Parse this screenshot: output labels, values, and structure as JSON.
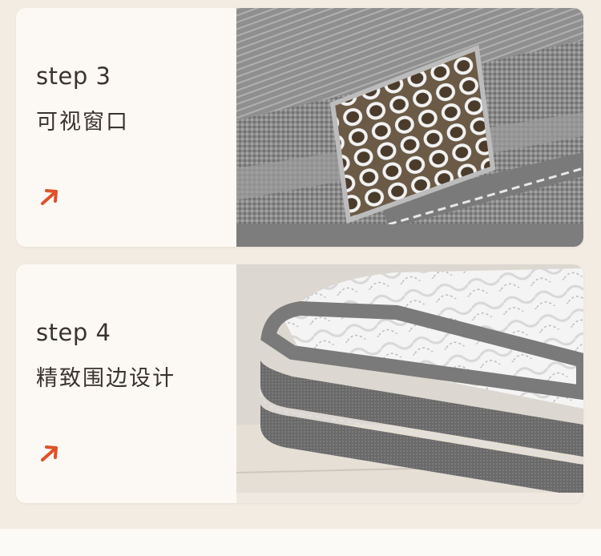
{
  "cards": [
    {
      "step": "step 3",
      "title": "可视窗口",
      "arrow_icon": "arrow-up-right-icon",
      "image": "mattress-mesh-window-photo"
    },
    {
      "step": "step 4",
      "title": "精致围边设计",
      "arrow_icon": "arrow-up-right-icon",
      "image": "mattress-edge-border-photo"
    }
  ],
  "colors": {
    "accent": "#e0502a",
    "text": "#3a3330",
    "card_bg": "#fcf9f4",
    "page_bg": "#f3ece3"
  }
}
